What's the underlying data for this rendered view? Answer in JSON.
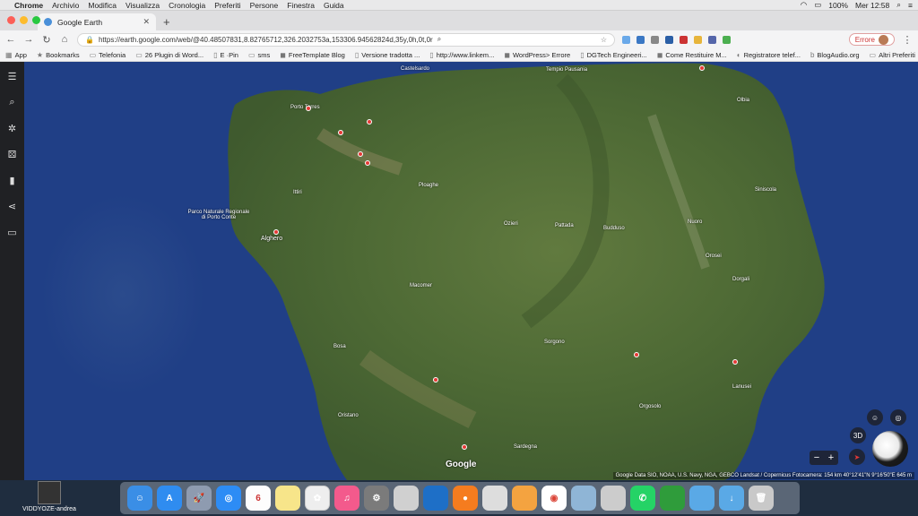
{
  "menubar": {
    "app_name": "Chrome",
    "items": [
      "Archivio",
      "Modifica",
      "Visualizza",
      "Cronologia",
      "Preferiti",
      "Persone",
      "Finestra",
      "Guida"
    ],
    "percent": "100%",
    "clock": "Mer 12:58"
  },
  "tab": {
    "title": "Google Earth",
    "close_icon": "close-icon",
    "new_tab_label": "+"
  },
  "toolbar": {
    "url": "https://earth.google.com/web/@40.48507831,8.82765712,326.2032753a,153306.94562824d,35y,0h,0t,0r",
    "error_label": "Errore"
  },
  "bookmarks": {
    "items": [
      "App",
      "Bookmarks",
      "Telefonia",
      "26 Plugin di Word...",
      "E ·Pin",
      "sms",
      "FreeTemplate Blog",
      "Versione tradotta ...",
      "http://www.linkem...",
      "WordPress> Errore",
      "DGTech Engineeri...",
      "Come Restituire M...",
      "Registratore telef...",
      "BlogAudio.org"
    ],
    "other": "Altri Preferiti"
  },
  "map": {
    "labels": [
      {
        "text": "Castelsardo"
      },
      {
        "text": "Tempio Pausania"
      },
      {
        "text": "Olbia"
      },
      {
        "text": "Alghero"
      },
      {
        "text": "Ozieri"
      },
      {
        "text": "Nuoro"
      },
      {
        "text": "Bosa"
      },
      {
        "text": "Orosei"
      },
      {
        "text": "Oristano"
      },
      {
        "text": "Sardegna"
      },
      {
        "text": "Siniscola"
      },
      {
        "text": "Pattada"
      },
      {
        "text": "Macomer"
      },
      {
        "text": "Ploaghe"
      },
      {
        "text": "Ittiri"
      },
      {
        "text": "Parco Naturale Regionale di Porto Conte"
      },
      {
        "text": "Lanusei"
      },
      {
        "text": "Dorgali"
      },
      {
        "text": "Sorgono"
      },
      {
        "text": "Orgosolo"
      },
      {
        "text": "Budduso"
      },
      {
        "text": "Porto Torres"
      }
    ],
    "brand": "Google",
    "credits": "Google  Data SIO, NOAA, U.S. Navy, NGA, GEBCO Landsat / Copernicus  Fotocamera: 154 km  40°12'41\"N 9°16'50\"E  645 m",
    "controls": {
      "three_d": "3D",
      "zoom_out": "−",
      "zoom_in": "+"
    }
  },
  "dock": {
    "desktop_file": "VIDDYOZE-andrea",
    "calendar_day": "6",
    "apps": [
      "finder-icon",
      "app-store-icon",
      "launchpad-icon",
      "safari-icon",
      "notes-icon",
      "calendar-icon",
      "photos-icon",
      "itunes-icon",
      "system-prefs-icon",
      "scanner-icon",
      "keynote-icon",
      "firefox-icon",
      "textedit-icon",
      "pages-icon",
      "chrome-icon",
      "preview-icon",
      "printer-icon",
      "whatsapp-icon",
      "camtasia-icon",
      "folder-icon",
      "downloads-icon",
      "trash-icon"
    ]
  }
}
